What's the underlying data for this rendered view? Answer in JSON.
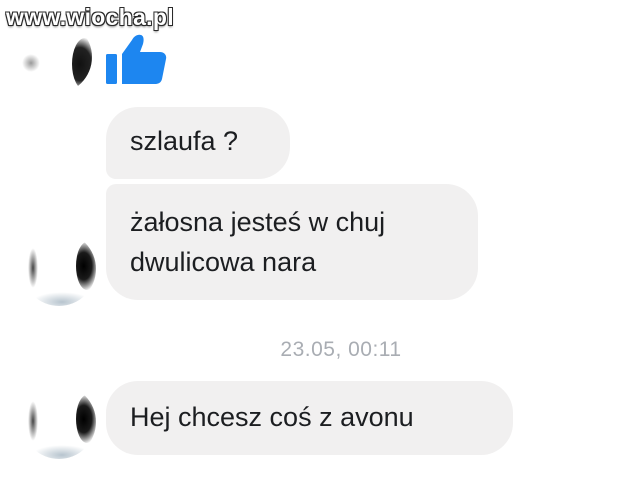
{
  "watermark": {
    "text": "www.wiocha.pl"
  },
  "colors": {
    "bubble_bg": "#f1f0f0",
    "text": "#1c1e21",
    "timestamp": "#a9adb3",
    "like": "#1d86f0"
  },
  "conversation": {
    "like_icon": "thumbs-up-icon",
    "messages": [
      {
        "lines": [
          "szlaufa ?"
        ]
      },
      {
        "lines": [
          "żałosna jesteś w chuj",
          "dwulicowa nara"
        ]
      }
    ],
    "timestamp": "23.05, 00:11",
    "last_message": {
      "lines": [
        "Hej chcesz coś z avonu"
      ]
    }
  }
}
